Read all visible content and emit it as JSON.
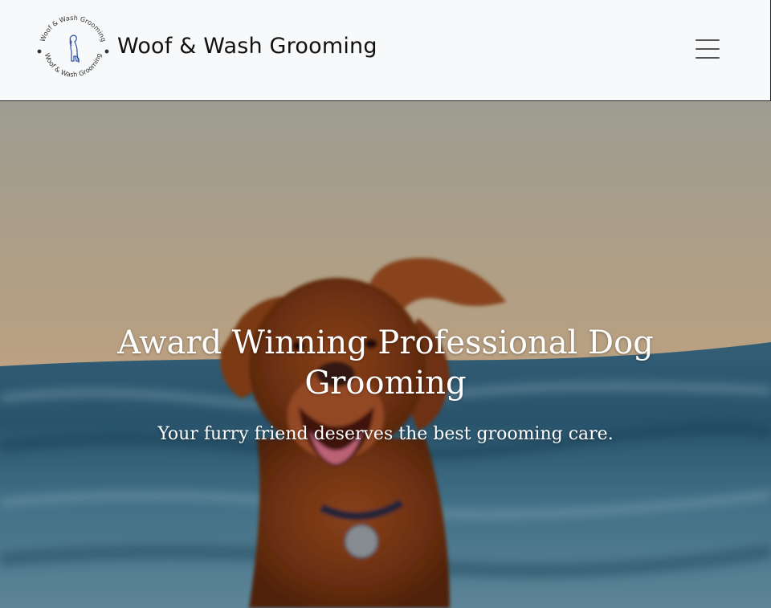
{
  "navbar": {
    "brand_name": "Woof & Wash Grooming",
    "logo_ring_text": "Woof & Wash Grooming",
    "menu_icon": "hamburger-menu-icon"
  },
  "hero": {
    "title": "Award Winning Professional Dog Grooming",
    "subtitle": "Your furry friend deserves the best grooming care.",
    "image_subject": "dog-running-on-beach"
  },
  "colors": {
    "navbar_bg": "#f8f9fa",
    "logo_dog": "#2c4f9e",
    "hero_text": "#ffffff"
  }
}
